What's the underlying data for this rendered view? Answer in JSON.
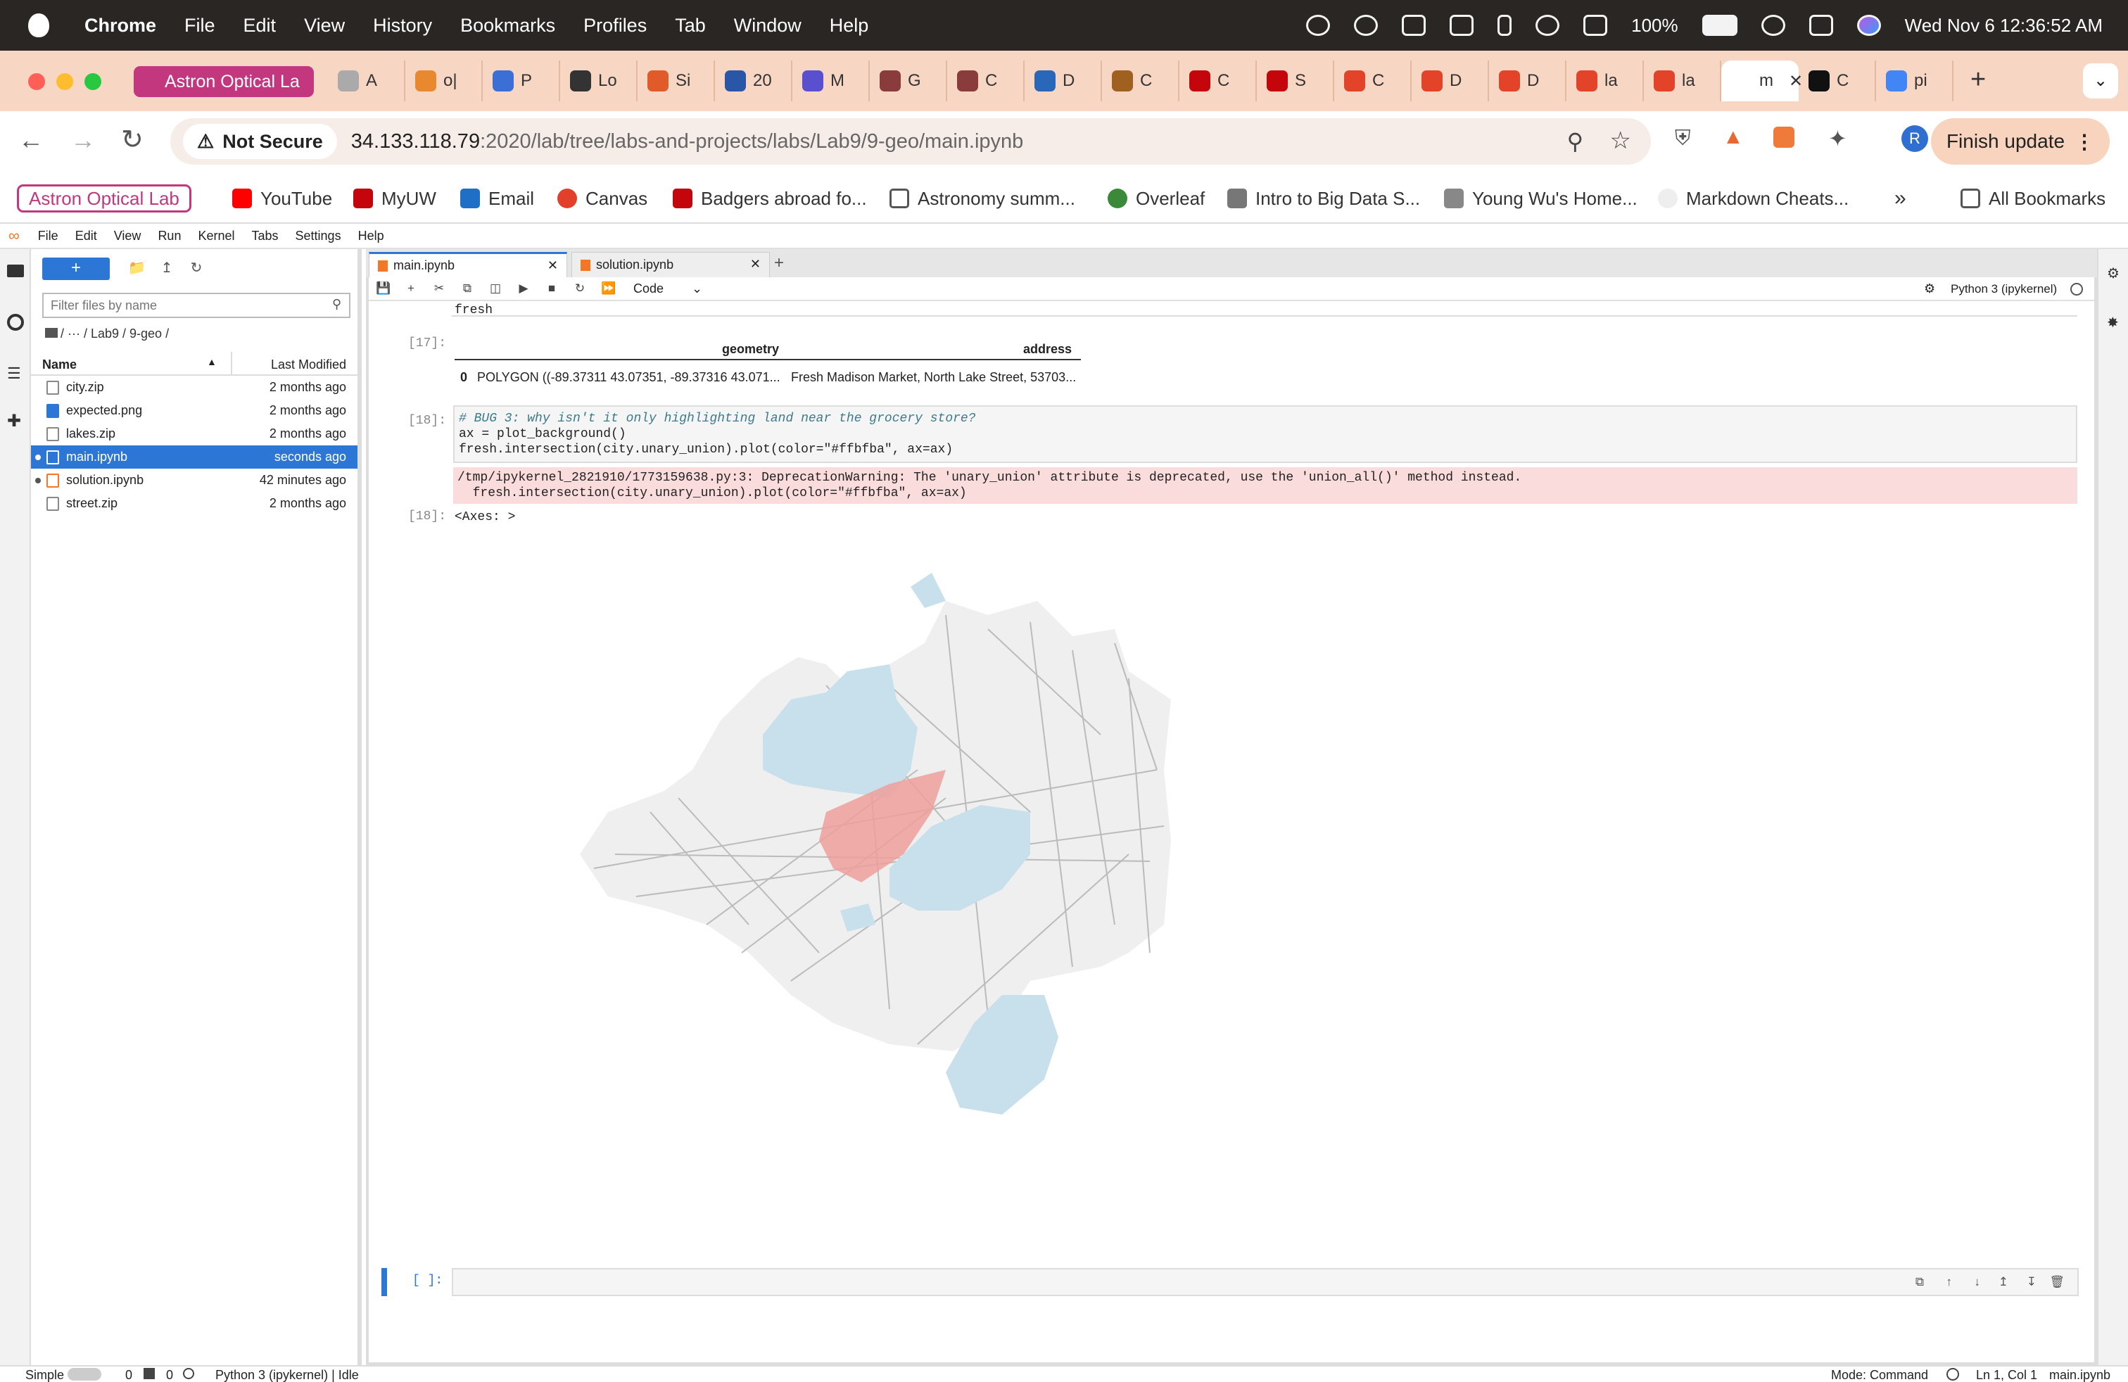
{
  "menubar": {
    "app": "Chrome",
    "items": [
      "File",
      "Edit",
      "View",
      "History",
      "Bookmarks",
      "Profiles",
      "Tab",
      "Window",
      "Help"
    ],
    "battery": "100%",
    "datetime": "Wed Nov 6  12:36:52 AM"
  },
  "tabs": {
    "group_label": "Astron Optical La",
    "items": [
      {
        "label": "A",
        "color": "#aaa"
      },
      {
        "label": "o|",
        "color": "#e8892f"
      },
      {
        "label": "P",
        "color": "#3b6fd6"
      },
      {
        "label": "Lo",
        "color": "#333"
      },
      {
        "label": "Si",
        "color": "#e05a2a"
      },
      {
        "label": "20",
        "color": "#2a56a8"
      },
      {
        "label": "M",
        "color": "#5a4fcf"
      },
      {
        "label": "G",
        "color": "#8a3b3b"
      },
      {
        "label": "C",
        "color": "#8a3b3b"
      },
      {
        "label": "D",
        "color": "#2a67b8"
      },
      {
        "label": "C",
        "color": "#a06020"
      },
      {
        "label": "C",
        "color": "#c5050c"
      },
      {
        "label": "S",
        "color": "#c5050c"
      },
      {
        "label": "C",
        "color": "#e24329"
      },
      {
        "label": "D",
        "color": "#e24329"
      },
      {
        "label": "D",
        "color": "#e24329"
      },
      {
        "label": "la",
        "color": "#e24329"
      },
      {
        "label": "la",
        "color": "#e24329"
      },
      {
        "label": "m",
        "color": "#fff"
      },
      {
        "label": "C",
        "color": "#111"
      },
      {
        "label": "pi",
        "color": "#4285f4"
      }
    ]
  },
  "address": {
    "security": "Not Secure",
    "host": "34.133.118.79",
    "path": ":2020/lab/tree/labs-and-projects/labs/Lab9/9-geo/main.ipynb",
    "finish_update": "Finish update",
    "profile": "R"
  },
  "bookmarks": {
    "group": "Astron Optical Lab",
    "items": [
      "YouTube",
      "MyUW",
      "Email",
      "Canvas",
      "Badgers abroad fo...",
      "Astronomy summ...",
      "Overleaf",
      "Intro to Big Data S...",
      "Young Wu's Home...",
      "Markdown Cheats..."
    ],
    "all": "All Bookmarks"
  },
  "jupyter_menu": [
    "File",
    "Edit",
    "View",
    "Run",
    "Kernel",
    "Tabs",
    "Settings",
    "Help"
  ],
  "filebrowser": {
    "new_label": "+",
    "filter_placeholder": "Filter files by name",
    "breadcrumb": "/   ···   / Lab9 / 9-geo /",
    "col_name": "Name",
    "col_modified": "Last Modified",
    "files": [
      {
        "name": "city.zip",
        "modified": "2 months ago"
      },
      {
        "name": "expected.png",
        "modified": "2 months ago"
      },
      {
        "name": "lakes.zip",
        "modified": "2 months ago"
      },
      {
        "name": "main.ipynb",
        "modified": "seconds ago"
      },
      {
        "name": "solution.ipynb",
        "modified": "42 minutes ago"
      },
      {
        "name": "street.zip",
        "modified": "2 months ago"
      }
    ]
  },
  "notebook_tabs": [
    "main.ipynb",
    "solution.ipynb"
  ],
  "toolbar": {
    "cell_type": "Code",
    "kernel": "Python 3 (ipykernel)"
  },
  "cells": {
    "top_text": "fresh",
    "p17": "[17]:",
    "df_headers": [
      "geometry",
      "address"
    ],
    "df_row": {
      "index": "0",
      "geometry": "POLYGON ((-89.37311 43.07351, -89.37316 43.071...",
      "address": "Fresh Madison Market, North Lake Street, 53703..."
    },
    "p18_in": "[18]:",
    "code_lines": [
      "# BUG 3: why isn't it only highlighting land near the grocery store?",
      "ax = plot_background()",
      "fresh.intersection(city.unary_union).plot(color=\"#ffbfba\", ax=ax)"
    ],
    "warn_lines": [
      "/tmp/ipykernel_2821910/1773159638.py:3: DeprecationWarning: The 'unary_union' attribute is deprecated, use the 'union_all()' method instead.",
      "  fresh.intersection(city.unary_union).plot(color=\"#ffbfba\", ax=ax)"
    ],
    "p18_out": "[18]:",
    "out_text": "<Axes: >",
    "empty_prompt": "[ ]:"
  },
  "colors": {
    "lake": "#c7e0ec",
    "highlight": "#ef9f9a",
    "land": "#efefef",
    "accent": "#2c77d6"
  },
  "statusbar": {
    "mode_label": "Simple",
    "n1": "0",
    "n2": "0",
    "kernel": "Python 3 (ipykernel) | Idle",
    "mode": "Mode: Command",
    "pos": "Ln 1, Col 1",
    "file": "main.ipynb"
  }
}
